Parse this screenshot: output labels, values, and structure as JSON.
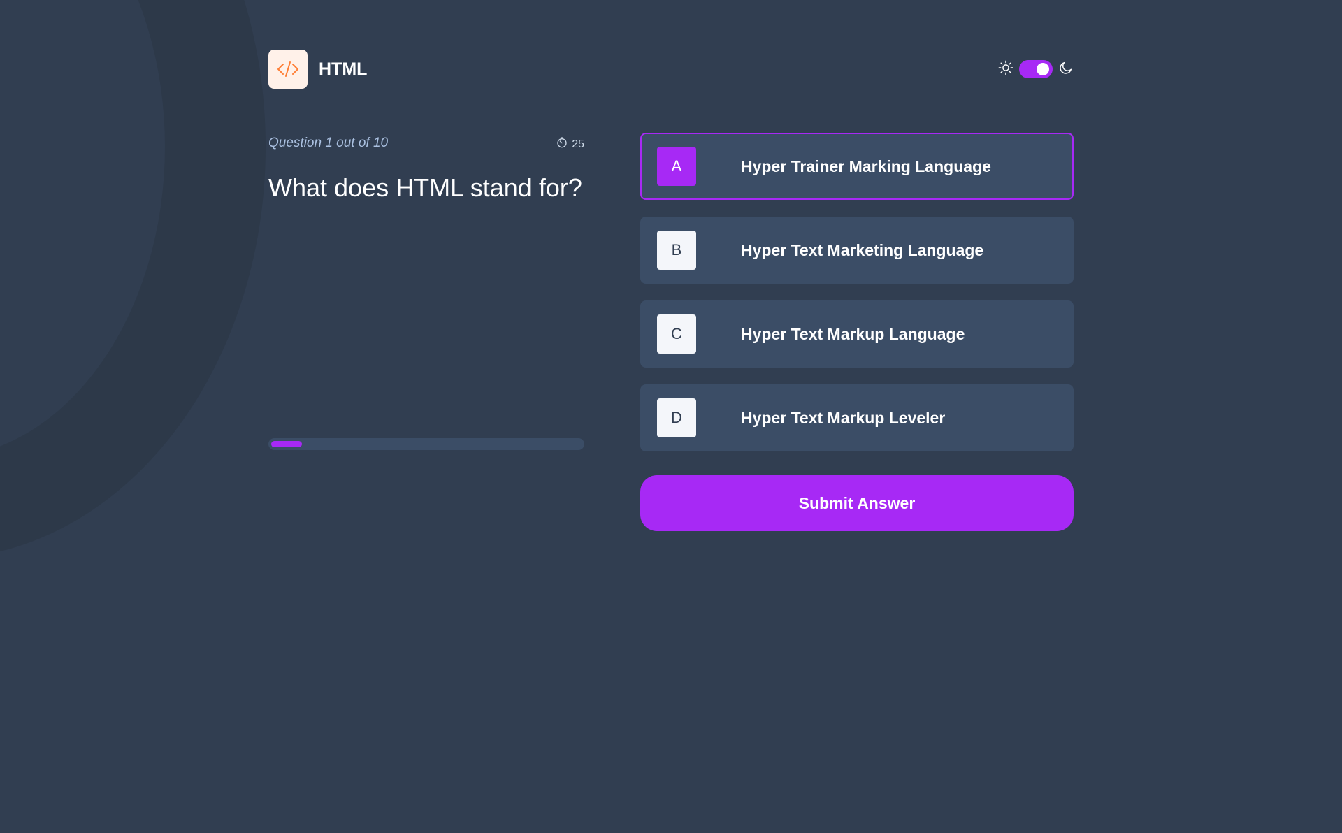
{
  "header": {
    "app_title": "HTML",
    "brand_icon": "code-brackets-icon",
    "theme": {
      "light_icon": "sun-icon",
      "dark_icon": "moon-icon",
      "dark_mode_on": true
    }
  },
  "quiz": {
    "question_count": "Question 1 out of 10",
    "timer_icon": "timer-icon",
    "timer_value": "25",
    "question": "What does HTML stand for?",
    "progress": 0.1,
    "options": [
      {
        "letter": "A",
        "text": "Hyper Trainer Marking Language",
        "selected": true
      },
      {
        "letter": "B",
        "text": "Hyper Text Marketing Language",
        "selected": false
      },
      {
        "letter": "C",
        "text": "Hyper Text Markup Language",
        "selected": false
      },
      {
        "letter": "D",
        "text": "Hyper Text Markup Leveler",
        "selected": false
      }
    ],
    "submit_label": "Submit Answer"
  },
  "colors": {
    "background": "#313e51",
    "accent": "#a729f5",
    "card": "#3b4d66",
    "brand_icon_bg": "#fff1e9",
    "brand_icon_fg": "#ff7e35"
  }
}
